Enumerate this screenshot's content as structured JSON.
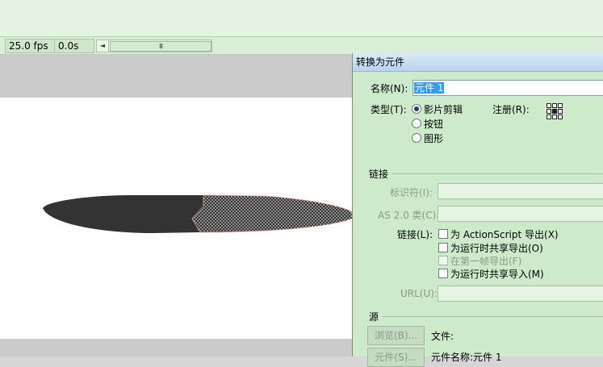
{
  "timeline": {
    "fps": "25.0 fps",
    "time": "0.0s",
    "scroll_left_icon": "◄",
    "scroll_thumb_grip": "III"
  },
  "dialog": {
    "title": "转换为元件",
    "name_label": "名称(N):",
    "name_value": "元件 1",
    "type_label": "类型(T):",
    "type_options": [
      "影片剪辑",
      "按钮",
      "图形"
    ],
    "type_selected": "影片剪辑",
    "registration_label": "注册(R):",
    "linkage": {
      "heading": "链接",
      "identifier_label": "标识符(I):",
      "identifier_value": "",
      "as2_class_label": "AS 2.0 类(C):",
      "as2_class_value": "",
      "linkage_label": "链接(L):",
      "options": [
        {
          "label": "为 ActionScript 导出(X)",
          "checked": false,
          "enabled": true
        },
        {
          "label": "为运行时共享导出(O)",
          "checked": false,
          "enabled": true
        },
        {
          "label": "在第一帧导出(F)",
          "checked": false,
          "enabled": false
        },
        {
          "label": "为运行时共享导入(M)",
          "checked": false,
          "enabled": true
        }
      ],
      "url_label": "URL(U):",
      "url_value": ""
    },
    "source": {
      "heading": "源",
      "browse_button": "浏览(B)...",
      "file_label": "文件:",
      "symbol_button": "元件(S)...",
      "symbol_name_label": "元件名称:元件 1"
    }
  },
  "colors": {
    "dialog_bg": "#cdebcb",
    "selection": "#3399ff",
    "shape_fill": "#333333",
    "stage_bg": "#ffffff"
  }
}
